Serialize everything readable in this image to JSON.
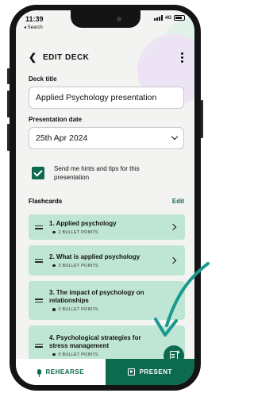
{
  "status_bar": {
    "time": "11:39",
    "back_label": "◂ Search",
    "network": "4G"
  },
  "header": {
    "title": "EDIT DECK"
  },
  "deck_title": {
    "label": "Deck title",
    "value": "Applied Psychology presentation"
  },
  "presentation_date": {
    "label": "Presentation date",
    "value": "25th Apr 2024"
  },
  "hints": {
    "label": "Send me hints and tips for this presentation",
    "checked": true
  },
  "flashcards": {
    "label": "Flashcards",
    "edit_label": "Edit",
    "items": [
      {
        "title": "1. Applied psychology",
        "subtitle": "2 BULLET POINTS"
      },
      {
        "title": "2. What is applied psychology",
        "subtitle": "3 BULLET POINTS"
      },
      {
        "title": "3. The impact of psychology on relationships",
        "subtitle": "0 BULLET POINTS"
      },
      {
        "title": "4. Psychological strategies for stress management",
        "subtitle": "0 BULLET POINTS"
      }
    ]
  },
  "bottom_bar": {
    "rehearse_label": "REHEARSE",
    "present_label": "PRESENT"
  },
  "colors": {
    "accent": "#0c6b4f",
    "card": "#bfe6d5",
    "arrow": "#1a9a8f"
  }
}
